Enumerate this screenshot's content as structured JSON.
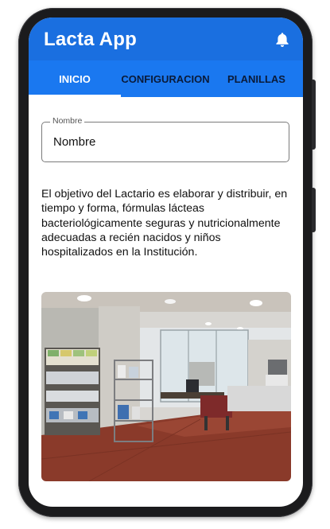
{
  "app": {
    "title": "Lacta App",
    "notification_icon": "bell-icon"
  },
  "tabs": [
    {
      "label": "INICIO",
      "selected": true
    },
    {
      "label": "CONFIGURACION",
      "selected": false
    },
    {
      "label": "PLANILLAS",
      "selected": false
    }
  ],
  "name_field": {
    "label": "Nombre",
    "value": "Nombre"
  },
  "description": "El objetivo del Lactario es elaborar y distribuir, en tiempo y forma, fórmulas lácteas bacteriológicamente seguras y nutricionalmente adecuadas a recién nacidos y niños hospitalizados en la Institución.",
  "photo": {
    "subject": "lactario-room-photo"
  },
  "colors": {
    "app_bar": "#1a6fe0",
    "tab_bar": "#1a78f0",
    "tab_text": "#0a1b3a",
    "selected_tab_text": "#ffffff",
    "frame": "#1b1b1d"
  }
}
